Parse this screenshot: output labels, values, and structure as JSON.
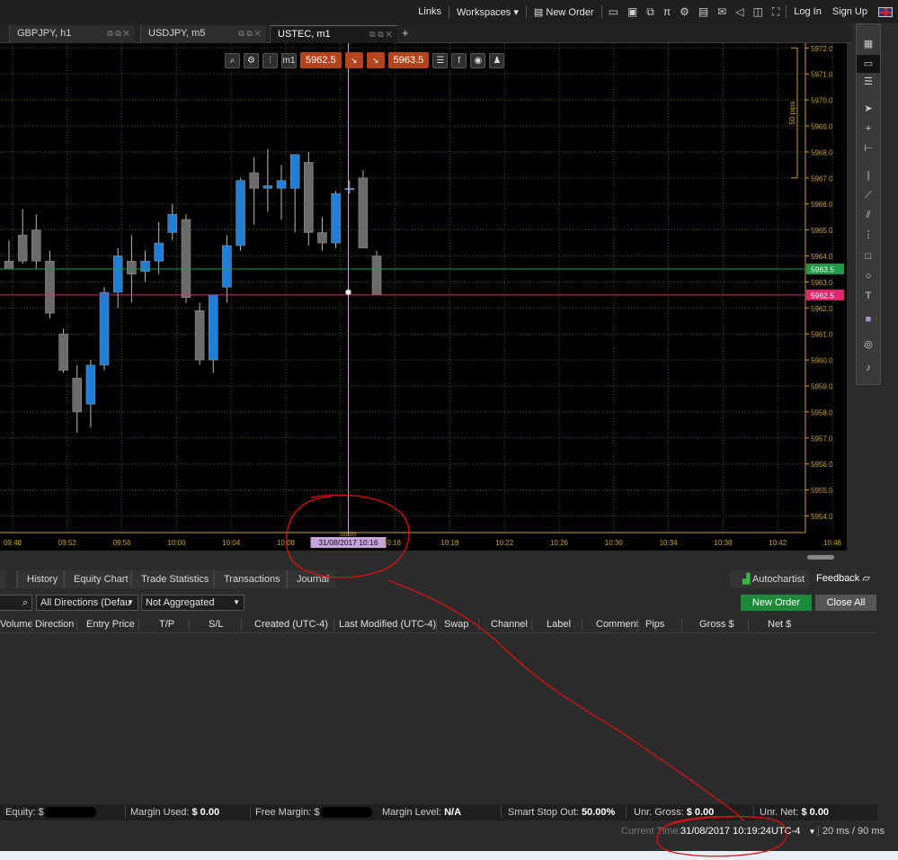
{
  "menubar": {
    "links": "Links",
    "workspaces": "Workspaces",
    "new_order": "New Order",
    "login": "Log In",
    "signup": "Sign Up"
  },
  "tabs": [
    {
      "label": "GBPJPY, h1"
    },
    {
      "label": "USDJPY, m5"
    },
    {
      "label": "USTEC, m1"
    }
  ],
  "chart_toolbar": {
    "timeframe": "m1",
    "sell_price": "5962.5",
    "buy_price": "5963.5"
  },
  "chart_data": {
    "type": "candlestick",
    "symbol": "USTEC",
    "timeframe": "m1",
    "y_ticks": [
      5954.0,
      5955.0,
      5956.0,
      5957.0,
      5958.0,
      5959.0,
      5960.0,
      5961.0,
      5962.0,
      5963.0,
      5964.0,
      5965.0,
      5966.0,
      5967.0,
      5968.0,
      5969.0,
      5970.0,
      5971.0,
      5972.0
    ],
    "x_ticks": [
      "09:48",
      "09:52",
      "09:56",
      "10:00",
      "10:04",
      "10:08",
      "10:12",
      "10:16",
      "10:18",
      "10:22",
      "10:26",
      "10:30",
      "10:34",
      "10:38",
      "10:42",
      "10:46"
    ],
    "pips_label": "50 pips",
    "bid_line": 5962.5,
    "ask_line": 5963.5,
    "bid_label": "5962.5",
    "ask_label": "5963.5",
    "crosshair_time_label": "31/08/2017 10:16",
    "crosshair_marker": "00:00",
    "candles": [
      {
        "o": 5963.8,
        "h": 5964.6,
        "l": 5963.5,
        "c": 5963.5,
        "dir": "down"
      },
      {
        "o": 5964.8,
        "h": 5965.8,
        "l": 5963.7,
        "c": 5963.8,
        "dir": "down"
      },
      {
        "o": 5965.0,
        "h": 5965.6,
        "l": 5963.5,
        "c": 5963.8,
        "dir": "down"
      },
      {
        "o": 5963.8,
        "h": 5964.2,
        "l": 5961.6,
        "c": 5961.8,
        "dir": "down"
      },
      {
        "o": 5961.0,
        "h": 5961.2,
        "l": 5959.5,
        "c": 5959.6,
        "dir": "down"
      },
      {
        "o": 5959.3,
        "h": 5959.8,
        "l": 5957.2,
        "c": 5958.0,
        "dir": "down"
      },
      {
        "o": 5958.3,
        "h": 5960.0,
        "l": 5957.4,
        "c": 5959.8,
        "dir": "up"
      },
      {
        "o": 5959.8,
        "h": 5962.8,
        "l": 5959.6,
        "c": 5962.6,
        "dir": "up"
      },
      {
        "o": 5962.6,
        "h": 5964.3,
        "l": 5962.0,
        "c": 5964.0,
        "dir": "up"
      },
      {
        "o": 5963.3,
        "h": 5964.8,
        "l": 5962.2,
        "c": 5963.8,
        "dir": "down"
      },
      {
        "o": 5963.4,
        "h": 5964.2,
        "l": 5963.0,
        "c": 5963.8,
        "dir": "up"
      },
      {
        "o": 5963.8,
        "h": 5965.3,
        "l": 5963.3,
        "c": 5964.5,
        "dir": "up"
      },
      {
        "o": 5964.9,
        "h": 5966.0,
        "l": 5964.6,
        "c": 5965.6,
        "dir": "up"
      },
      {
        "o": 5965.4,
        "h": 5965.6,
        "l": 5962.2,
        "c": 5962.4,
        "dir": "down"
      },
      {
        "o": 5961.9,
        "h": 5962.2,
        "l": 5959.8,
        "c": 5960.0,
        "dir": "down"
      },
      {
        "o": 5960.0,
        "h": 5962.4,
        "l": 5959.5,
        "c": 5962.5,
        "dir": "up"
      },
      {
        "o": 5962.8,
        "h": 5964.8,
        "l": 5962.2,
        "c": 5964.4,
        "dir": "up"
      },
      {
        "o": 5964.4,
        "h": 5967.0,
        "l": 5964.2,
        "c": 5966.9,
        "dir": "up"
      },
      {
        "o": 5966.6,
        "h": 5967.8,
        "l": 5965.2,
        "c": 5967.2,
        "dir": "down"
      },
      {
        "o": 5966.6,
        "h": 5968.1,
        "l": 5965.7,
        "c": 5966.7,
        "dir": "up"
      },
      {
        "o": 5966.6,
        "h": 5967.5,
        "l": 5965.4,
        "c": 5966.9,
        "dir": "up"
      },
      {
        "o": 5966.6,
        "h": 5967.6,
        "l": 5964.9,
        "c": 5967.9,
        "dir": "up"
      },
      {
        "o": 5967.6,
        "h": 5968.0,
        "l": 5964.4,
        "c": 5964.9,
        "dir": "down"
      },
      {
        "o": 5964.9,
        "h": 5965.5,
        "l": 5964.2,
        "c": 5964.5,
        "dir": "down"
      },
      {
        "o": 5964.5,
        "h": 5966.5,
        "l": 5964.3,
        "c": 5966.4,
        "dir": "up"
      },
      {
        "o": 5966.6,
        "h": 5966.9,
        "l": 5966.4,
        "c": 5966.6,
        "dir": "up"
      },
      {
        "o": 5967.0,
        "h": 5967.3,
        "l": 5964.3,
        "c": 5964.3,
        "dir": "down"
      },
      {
        "o": 5964.0,
        "h": 5964.2,
        "l": 5962.5,
        "c": 5962.5,
        "dir": "down"
      }
    ]
  },
  "bottom_tabs": [
    {
      "label": "History"
    },
    {
      "label": "Equity Chart"
    },
    {
      "label": "Trade Statistics"
    },
    {
      "label": "Transactions"
    },
    {
      "label": "Journal"
    }
  ],
  "autochartist": "Autochartist",
  "feedback": "Feedback",
  "filters": {
    "direction": "All Directions (Defau",
    "aggregation": "Not Aggregated"
  },
  "actions": {
    "new_order": "New Order",
    "close_all": "Close All"
  },
  "columns": [
    "Volume",
    "Direction",
    "Entry Price",
    "T/P",
    "S/L",
    "Created (UTC-4)",
    "Last Modified (UTC-4)",
    "Swap",
    "Channel",
    "Label",
    "Comment",
    "Pips",
    "Gross $",
    "Net $"
  ],
  "account": {
    "equity_label": "Equity: $",
    "margin_used_label": "Margin Used:",
    "margin_used_value": "$ 0.00",
    "free_margin_label": "Free Margin: $",
    "margin_level_label": "Margin Level:",
    "margin_level_value": "N/A",
    "smart_stop_label": "Smart Stop Out:",
    "smart_stop_value": "50.00%",
    "unr_gross_label": "Unr. Gross:",
    "unr_gross_value": "$ 0.00",
    "unr_net_label": "Unr. Net:",
    "unr_net_value": "$ 0.00"
  },
  "status": {
    "current_time_label": "Current Time:",
    "current_time_value": "31/08/2017 10:19:24",
    "timezone": "UTC-4",
    "latency": "20 ms / 90 ms"
  },
  "colors": {
    "bull": "#1e7fd8",
    "bear": "#6b6b6b",
    "bid": "#e0276f",
    "ask": "#1f9a48",
    "grid": "#5f5020",
    "annotation": "#dd1111"
  }
}
